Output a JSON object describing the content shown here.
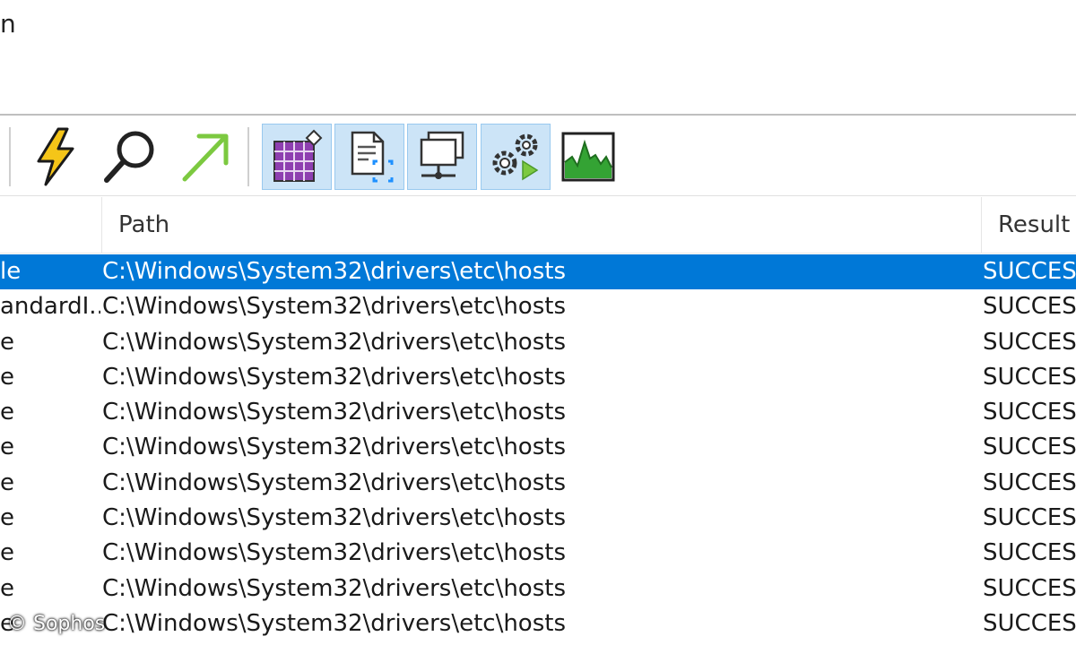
{
  "menu": {
    "fragment": "n"
  },
  "toolbar": {
    "buttons": [
      {
        "name": "lightning-icon",
        "pressed": false
      },
      {
        "name": "magnifier-icon",
        "pressed": false
      },
      {
        "name": "jump-arrow-icon",
        "pressed": false
      },
      {
        "name": "registry-grid-icon",
        "pressed": true
      },
      {
        "name": "file-system-icon",
        "pressed": true
      },
      {
        "name": "network-icon",
        "pressed": true
      },
      {
        "name": "process-gears-icon",
        "pressed": true
      },
      {
        "name": "profiling-chart-icon",
        "pressed": false
      }
    ]
  },
  "table": {
    "columns": [
      "Path",
      "Result"
    ],
    "rows": [
      {
        "op": "le",
        "path": "C:\\Windows\\System32\\drivers\\etc\\hosts",
        "result": "SUCCESS",
        "selected": true
      },
      {
        "op": "andardI...",
        "path": "C:\\Windows\\System32\\drivers\\etc\\hosts",
        "result": "SUCCESS",
        "selected": false
      },
      {
        "op": "e",
        "path": "C:\\Windows\\System32\\drivers\\etc\\hosts",
        "result": "SUCCESS",
        "selected": false
      },
      {
        "op": "e",
        "path": "C:\\Windows\\System32\\drivers\\etc\\hosts",
        "result": "SUCCESS",
        "selected": false
      },
      {
        "op": "e",
        "path": "C:\\Windows\\System32\\drivers\\etc\\hosts",
        "result": "SUCCESS",
        "selected": false
      },
      {
        "op": "e",
        "path": "C:\\Windows\\System32\\drivers\\etc\\hosts",
        "result": "SUCCESS",
        "selected": false
      },
      {
        "op": "e",
        "path": "C:\\Windows\\System32\\drivers\\etc\\hosts",
        "result": "SUCCESS",
        "selected": false
      },
      {
        "op": "e",
        "path": "C:\\Windows\\System32\\drivers\\etc\\hosts",
        "result": "SUCCESS",
        "selected": false
      },
      {
        "op": "e",
        "path": "C:\\Windows\\System32\\drivers\\etc\\hosts",
        "result": "SUCCESS",
        "selected": false
      },
      {
        "op": "e",
        "path": "C:\\Windows\\System32\\drivers\\etc\\hosts",
        "result": "SUCCESS",
        "selected": false
      },
      {
        "op": "e",
        "path": "C:\\Windows\\System32\\drivers\\etc\\hosts",
        "result": "SUCCESS",
        "selected": false
      }
    ]
  },
  "watermark": "© Sophos",
  "colors": {
    "selection": "#0078d7",
    "pressed_button": "#cce4f7",
    "lightning": "#f5c518",
    "arrow": "#7cc940",
    "chart_fill": "#34a334"
  }
}
